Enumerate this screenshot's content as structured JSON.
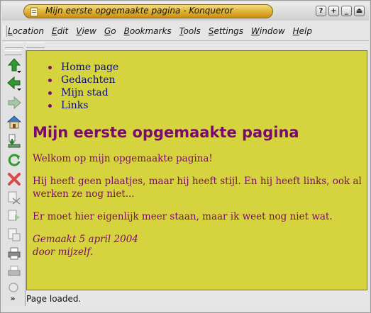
{
  "window": {
    "title": "Mijn eerste opgemaakte pagina - Konqueror"
  },
  "window_buttons": [
    {
      "name": "help-button",
      "glyph": "?"
    },
    {
      "name": "maximize-button",
      "glyph": "+"
    },
    {
      "name": "minimize-button",
      "glyph": "_"
    },
    {
      "name": "shade-button",
      "glyph": "⏏"
    }
  ],
  "menubar": {
    "items": [
      "Location",
      "Edit",
      "View",
      "Go",
      "Bookmarks",
      "Tools",
      "Settings",
      "Window",
      "Help"
    ]
  },
  "toolbar": {
    "tools": [
      {
        "name": "up-arrow-icon",
        "color": "#2f9a2f"
      },
      {
        "name": "back-arrow-icon",
        "color": "#2f9a2f"
      },
      {
        "name": "forward-arrow-icon",
        "color": "#a6c8a6"
      },
      {
        "name": "home-icon",
        "color": "#3a7fc4"
      },
      {
        "name": "download-icon",
        "color": "#6a9a6a"
      },
      {
        "name": "reload-icon",
        "color": "#2f9a2f"
      },
      {
        "name": "stop-icon",
        "color": "#d84a4a"
      },
      {
        "name": "cut-icon",
        "color": "#9a9a9a"
      },
      {
        "name": "copy-icon",
        "color": "#9a9a9a"
      },
      {
        "name": "paste-icon",
        "color": "#9a9a9a"
      },
      {
        "name": "print-icon",
        "color": "#8a8a8a"
      },
      {
        "name": "print-preview-icon",
        "color": "#b0b0b0"
      },
      {
        "name": "find-icon",
        "color": "#b0b0b0"
      }
    ],
    "more_glyph": "»"
  },
  "page": {
    "links": [
      "Home page",
      "Gedachten",
      "Mijn stad",
      "Links"
    ],
    "heading": "Mijn eerste opgemaakte pagina",
    "paragraphs": [
      "Welkom op mijn opgemaakte pagina!",
      "Hij heeft geen plaatjes, maar hij heeft stijl. En hij heeft links, ook al werken ze nog niet...",
      "Er moet hier eigenlijk meer staan, maar ik weet nog niet wat."
    ],
    "signature": [
      "Gemaakt 5 april 2004",
      "door mijzelf."
    ],
    "background_color": "#d6d43e",
    "text_color": "#7a0a6e",
    "link_color": "#0b0b7a"
  },
  "status": {
    "text": "Page loaded."
  }
}
